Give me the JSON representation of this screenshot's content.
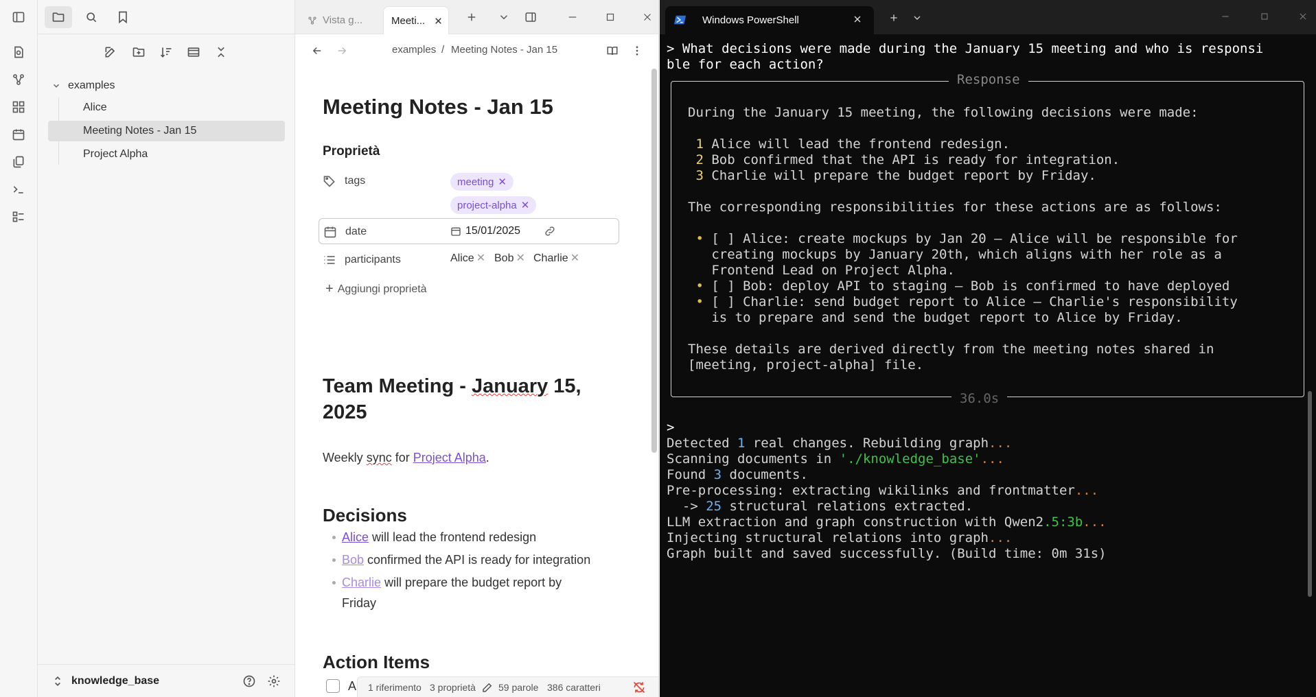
{
  "obsidian": {
    "sidebar": {
      "folder": "examples",
      "files": [
        "Alice",
        "Meeting Notes - Jan 15",
        "Project Alpha"
      ],
      "vault_name": "knowledge_base"
    },
    "tabs": {
      "inactive_label": "Vista g...",
      "active_label": "Meeti..."
    },
    "breadcrumb": {
      "folder": "examples",
      "separator": "/",
      "note": "Meeting Notes - Jan 15"
    },
    "doc": {
      "title": "Meeting Notes - Jan 15",
      "properties_heading": "Proprietà",
      "props": {
        "tags_key": "tags",
        "tags": [
          "meeting",
          "project-alpha"
        ],
        "date_key": "date",
        "date_value": "15/01/2025",
        "participants_key": "participants",
        "participants": [
          "Alice",
          "Bob",
          "Charlie"
        ],
        "add_label": "Aggiungi proprietà"
      },
      "heading1_line1_a": "Team Meeting - ",
      "heading1_line1_b": "January",
      "heading1_line1_c": " 15,",
      "heading1_line2": "2025",
      "intro_a": "Weekly ",
      "intro_sync": "sync",
      "intro_b": " for ",
      "intro_link": "Project Alpha",
      "intro_c": ".",
      "decisions_heading": "Decisions",
      "decisions": [
        {
          "link": "Alice",
          "rest": " will lead the frontend redesign"
        },
        {
          "link": "Bob",
          "rest": " confirmed the API is ready for integration"
        },
        {
          "link": "Charlie",
          "rest": " will prepare the budget report by Friday"
        }
      ],
      "action_heading": "Action Items",
      "action_first_char": "A"
    },
    "status": {
      "backlinks": "1 riferimento",
      "props": "3 proprietà",
      "words": "59 parole",
      "chars": "386 caratteri"
    }
  },
  "terminal": {
    "tab_title": "Windows PowerShell",
    "question_l1": "> What decisions were made during the January 15 meeting and who is responsi",
    "question_l2": "ble for each action?",
    "panel_title": "Response",
    "panel_time": "36.0s",
    "resp_intro": "During the January 15 meeting, the following decisions were made:",
    "resp_numbered": [
      {
        "n": "1",
        "text": "Alice will lead the frontend redesign."
      },
      {
        "n": "2",
        "text": "Bob confirmed that the API is ready for integration."
      },
      {
        "n": "3",
        "text": "Charlie will prepare the budget report by Friday."
      }
    ],
    "resp_resp": "The corresponding responsibilities for these actions are as follows:",
    "resp_bullets": [
      [
        "[ ] Alice: create mockups by Jan 20 – Alice will be responsible for",
        "creating mockups by January 20th, which aligns with her role as a",
        "Frontend Lead on Project Alpha."
      ],
      [
        "[ ] Bob: deploy API to staging – Bob is confirmed to have deployed"
      ],
      [
        "[ ] Charlie: send budget report to Alice – Charlie's responsibility",
        "is to prepare and send the budget report to Alice by Friday."
      ]
    ],
    "resp_outro_l1": "These details are derived directly from the meeting notes shared in",
    "resp_outro_l2": "[meeting, project-alpha] file.",
    "prompt": ">",
    "log": {
      "l1_a": "Detected ",
      "l1_n": "1",
      "l1_b": " real changes. Rebuilding graph",
      "l1_d": "...",
      "l2_a": "Scanning documents in ",
      "l2_path": "'./knowledge_base'",
      "l2_d": "...",
      "l3_a": "Found ",
      "l3_n": "3",
      "l3_b": " documents.",
      "l4_a": "Pre-processing: extracting wikilinks and frontmatter",
      "l4_d": "...",
      "l5_a": "  -> ",
      "l5_n": "25",
      "l5_b": " structural relations extracted.",
      "l6_a": "LLM extraction and graph construction with Qwen2",
      "l6_v": ".5:3b",
      "l6_d": "...",
      "l7_a": "Injecting structural relations into graph",
      "l7_d": "...",
      "l8": "Graph built and saved successfully. (Build time: 0m 31s)"
    }
  },
  "colors": {
    "accent_purple": "#7a4fd6",
    "terminal_bg": "#0c0c0c",
    "terminal_blue": "#6cb2f0",
    "terminal_green": "#3fc24a",
    "terminal_orange": "#d3803a"
  }
}
